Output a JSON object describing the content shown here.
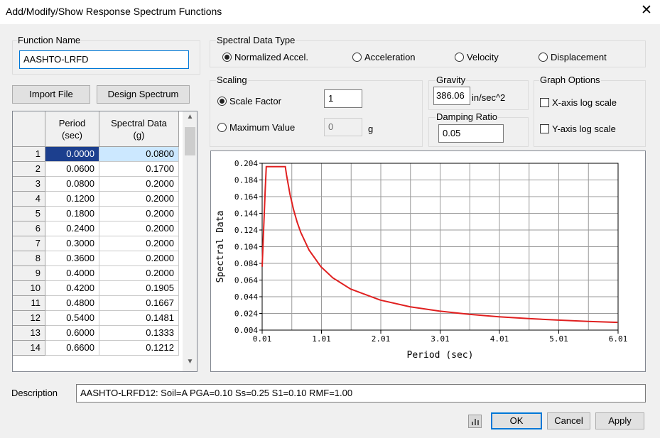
{
  "window": {
    "title": "Add/Modify/Show Response Spectrum Functions",
    "close_glyph": "✕"
  },
  "function_name": {
    "label": "Function Name",
    "value": "AASHTO-LRFD"
  },
  "buttons": {
    "import_file": "Import File",
    "design_spectrum": "Design Spectrum",
    "ok": "OK",
    "cancel": "Cancel",
    "apply": "Apply"
  },
  "spectral_data_type": {
    "label": "Spectral Data Type",
    "options": [
      {
        "label": "Normalized Accel.",
        "selected": true
      },
      {
        "label": "Acceleration",
        "selected": false
      },
      {
        "label": "Velocity",
        "selected": false
      },
      {
        "label": "Displacement",
        "selected": false
      }
    ]
  },
  "scaling": {
    "label": "Scaling",
    "scale_factor_label": "Scale Factor",
    "scale_factor_value": "1",
    "maximum_value_label": "Maximum Value",
    "maximum_value_value": "0",
    "maximum_value_unit": "g"
  },
  "gravity": {
    "label": "Gravity",
    "value": "386.06",
    "unit": "in/sec^2"
  },
  "damping": {
    "label": "Damping Ratio",
    "value": "0.05"
  },
  "graph_options": {
    "label": "Graph Options",
    "x_log_label": "X-axis log scale",
    "y_log_label": "Y-axis log scale"
  },
  "table": {
    "col_period": "Period\n(sec)",
    "col_spectral": "Spectral Data\n(g)",
    "rows": [
      {
        "n": "1",
        "period": "0.0000",
        "value": "0.0800"
      },
      {
        "n": "2",
        "period": "0.0600",
        "value": "0.1700"
      },
      {
        "n": "3",
        "period": "0.0800",
        "value": "0.2000"
      },
      {
        "n": "4",
        "period": "0.1200",
        "value": "0.2000"
      },
      {
        "n": "5",
        "period": "0.1800",
        "value": "0.2000"
      },
      {
        "n": "6",
        "period": "0.2400",
        "value": "0.2000"
      },
      {
        "n": "7",
        "period": "0.3000",
        "value": "0.2000"
      },
      {
        "n": "8",
        "period": "0.3600",
        "value": "0.2000"
      },
      {
        "n": "9",
        "period": "0.4000",
        "value": "0.2000"
      },
      {
        "n": "10",
        "period": "0.4200",
        "value": "0.1905"
      },
      {
        "n": "11",
        "period": "0.4800",
        "value": "0.1667"
      },
      {
        "n": "12",
        "period": "0.5400",
        "value": "0.1481"
      },
      {
        "n": "13",
        "period": "0.6000",
        "value": "0.1333"
      },
      {
        "n": "14",
        "period": "0.6600",
        "value": "0.1212"
      }
    ]
  },
  "description": {
    "label": "Description",
    "value": "AASHTO-LRFD12: Soil=A PGA=0.10 Ss=0.25 S1=0.10 RMF=1.00"
  },
  "chart_data": {
    "type": "line",
    "xlabel": "Period (sec)",
    "ylabel": "Spectral Data",
    "xlim": [
      0.01,
      6.01
    ],
    "ylim": [
      0.004,
      0.204
    ],
    "x_ticks": [
      "0.01",
      "1.01",
      "2.01",
      "3.01",
      "4.01",
      "5.01",
      "6.01"
    ],
    "y_ticks": [
      "0.004",
      "0.024",
      "0.044",
      "0.064",
      "0.084",
      "0.104",
      "0.124",
      "0.144",
      "0.164",
      "0.184",
      "0.204"
    ],
    "line_color": "#e02020",
    "grid": true,
    "series": [
      {
        "x": [
          0.0,
          0.06,
          0.08,
          0.12,
          0.18,
          0.24,
          0.3,
          0.36,
          0.4,
          0.42,
          0.48,
          0.54,
          0.6,
          0.66,
          0.8,
          1.0,
          1.2,
          1.5,
          2.0,
          2.5,
          3.0,
          3.5,
          4.0,
          4.5,
          5.0,
          5.5,
          6.0
        ],
        "y": [
          0.08,
          0.17,
          0.2,
          0.2,
          0.2,
          0.2,
          0.2,
          0.2,
          0.2,
          0.1905,
          0.1667,
          0.1481,
          0.1333,
          0.1212,
          0.1,
          0.08,
          0.0667,
          0.0533,
          0.04,
          0.032,
          0.0267,
          0.0229,
          0.02,
          0.0178,
          0.016,
          0.0145,
          0.0133
        ]
      }
    ]
  }
}
